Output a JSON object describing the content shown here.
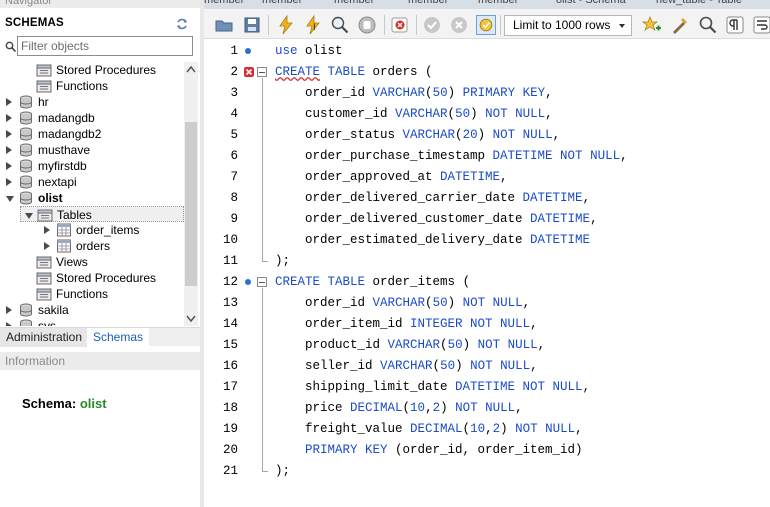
{
  "navigator": {
    "title": "Navigator",
    "schemas_header": "SCHEMAS",
    "filter_placeholder": "Filter objects"
  },
  "tree": {
    "top_items": [
      "Stored Procedures",
      "Functions"
    ],
    "schemas": [
      "hr",
      "madangdb",
      "madangdb2",
      "musthave",
      "myfirstdb",
      "nextapi"
    ],
    "open_schema": "olist",
    "tables_label": "Tables",
    "tables": [
      "order_items",
      "orders"
    ],
    "views_label": "Views",
    "stored_procedures_label": "Stored Procedures",
    "functions_label": "Functions",
    "after_schemas": [
      "sakila",
      "sys"
    ]
  },
  "bottom_tabs": {
    "administration": "Administration",
    "schemas": "Schemas"
  },
  "information": {
    "title": "Information",
    "schema_label": "Schema:",
    "schema_value": "olist"
  },
  "top_tabs": [
    "member",
    "member",
    "member",
    "member",
    "member",
    "olist - Schema",
    "new_table - Table"
  ],
  "toolbar": {
    "limit_label": "Limit to 1000 rows",
    "icons": [
      "open-folder-icon",
      "save-icon",
      "execute-icon",
      "execute-current-icon",
      "explain-icon",
      "stop-icon",
      "toggle-error-icon",
      "commit-icon",
      "rollback-icon",
      "autocommit-icon",
      "limit-select",
      "add-snippet-icon",
      "beautify-icon",
      "find-icon",
      "invisible-chars-icon",
      "wrap-icon"
    ]
  },
  "colors": {
    "keyword": "#1a4bc8",
    "schema_value": "#2a8a2a",
    "marker": "#2b6fd1",
    "error": "#d32f2f"
  },
  "editor": {
    "lines": [
      {
        "n": "1",
        "marker": "dot",
        "tokens": [
          [
            "kw",
            "use"
          ],
          [
            "t",
            " olist"
          ]
        ]
      },
      {
        "n": "2",
        "marker": "error",
        "fold": true,
        "tokens": [
          [
            "kwerr",
            "CREATE"
          ],
          [
            "t",
            " "
          ],
          [
            "kw",
            "TABLE"
          ],
          [
            "t",
            " orders ("
          ]
        ]
      },
      {
        "n": "3",
        "tokens": [
          [
            "t",
            "    order_id "
          ],
          [
            "kw",
            "VARCHAR"
          ],
          [
            "t",
            "("
          ],
          [
            "num",
            "50"
          ],
          [
            "t",
            ") "
          ],
          [
            "kw",
            "PRIMARY KEY"
          ],
          [
            "t",
            ","
          ]
        ]
      },
      {
        "n": "4",
        "tokens": [
          [
            "t",
            "    customer_id "
          ],
          [
            "kw",
            "VARCHAR"
          ],
          [
            "t",
            "("
          ],
          [
            "num",
            "50"
          ],
          [
            "t",
            ") "
          ],
          [
            "kw",
            "NOT NULL"
          ],
          [
            "t",
            ","
          ]
        ]
      },
      {
        "n": "5",
        "tokens": [
          [
            "t",
            "    order_status "
          ],
          [
            "kw",
            "VARCHAR"
          ],
          [
            "t",
            "("
          ],
          [
            "num",
            "20"
          ],
          [
            "t",
            ") "
          ],
          [
            "kw",
            "NOT NULL"
          ],
          [
            "t",
            ","
          ]
        ]
      },
      {
        "n": "6",
        "tokens": [
          [
            "t",
            "    order_purchase_timestamp "
          ],
          [
            "kw",
            "DATETIME NOT NULL"
          ],
          [
            "t",
            ","
          ]
        ]
      },
      {
        "n": "7",
        "tokens": [
          [
            "t",
            "    order_approved_at "
          ],
          [
            "kw",
            "DATETIME"
          ],
          [
            "t",
            ","
          ]
        ]
      },
      {
        "n": "8",
        "tokens": [
          [
            "t",
            "    order_delivered_carrier_date "
          ],
          [
            "kw",
            "DATETIME"
          ],
          [
            "t",
            ","
          ]
        ]
      },
      {
        "n": "9",
        "tokens": [
          [
            "t",
            "    order_delivered_customer_date "
          ],
          [
            "kw",
            "DATETIME"
          ],
          [
            "t",
            ","
          ]
        ]
      },
      {
        "n": "10",
        "tokens": [
          [
            "t",
            "    order_estimated_delivery_date "
          ],
          [
            "kw",
            "DATETIME"
          ]
        ]
      },
      {
        "n": "11",
        "tokens": [
          [
            "t",
            ");"
          ]
        ]
      },
      {
        "n": "12",
        "marker": "dot",
        "fold": true,
        "tokens": [
          [
            "kw",
            "CREATE"
          ],
          [
            "t",
            " "
          ],
          [
            "kw",
            "TABLE"
          ],
          [
            "t",
            " order_items ("
          ]
        ]
      },
      {
        "n": "13",
        "tokens": [
          [
            "t",
            "    order_id "
          ],
          [
            "kw",
            "VARCHAR"
          ],
          [
            "t",
            "("
          ],
          [
            "num",
            "50"
          ],
          [
            "t",
            ") "
          ],
          [
            "kw",
            "NOT NULL"
          ],
          [
            "t",
            ","
          ]
        ]
      },
      {
        "n": "14",
        "tokens": [
          [
            "t",
            "    order_item_id "
          ],
          [
            "kw",
            "INTEGER NOT NULL"
          ],
          [
            "t",
            ","
          ]
        ]
      },
      {
        "n": "15",
        "tokens": [
          [
            "t",
            "    product_id "
          ],
          [
            "kw",
            "VARCHAR"
          ],
          [
            "t",
            "("
          ],
          [
            "num",
            "50"
          ],
          [
            "t",
            ") "
          ],
          [
            "kw",
            "NOT NULL"
          ],
          [
            "t",
            ","
          ]
        ]
      },
      {
        "n": "16",
        "tokens": [
          [
            "t",
            "    seller_id "
          ],
          [
            "kw",
            "VARCHAR"
          ],
          [
            "t",
            "("
          ],
          [
            "num",
            "50"
          ],
          [
            "t",
            ") "
          ],
          [
            "kw",
            "NOT NULL"
          ],
          [
            "t",
            ","
          ]
        ]
      },
      {
        "n": "17",
        "tokens": [
          [
            "t",
            "    shipping_limit_date "
          ],
          [
            "kw",
            "DATETIME NOT NULL"
          ],
          [
            "t",
            ","
          ]
        ]
      },
      {
        "n": "18",
        "tokens": [
          [
            "t",
            "    price "
          ],
          [
            "kw",
            "DECIMAL"
          ],
          [
            "t",
            "("
          ],
          [
            "num",
            "10"
          ],
          [
            "t",
            ","
          ],
          [
            "num",
            "2"
          ],
          [
            "t",
            ") "
          ],
          [
            "kw",
            "NOT NULL"
          ],
          [
            "t",
            ","
          ]
        ]
      },
      {
        "n": "19",
        "tokens": [
          [
            "t",
            "    freight_value "
          ],
          [
            "kw",
            "DECIMAL"
          ],
          [
            "t",
            "("
          ],
          [
            "num",
            "10"
          ],
          [
            "t",
            ","
          ],
          [
            "num",
            "2"
          ],
          [
            "t",
            ") "
          ],
          [
            "kw",
            "NOT NULL"
          ],
          [
            "t",
            ","
          ]
        ]
      },
      {
        "n": "20",
        "tokens": [
          [
            "t",
            "    "
          ],
          [
            "kw",
            "PRIMARY KEY"
          ],
          [
            "t",
            " (order_id, order_item_id)"
          ]
        ]
      },
      {
        "n": "21",
        "tokens": [
          [
            "t",
            ");"
          ]
        ]
      }
    ]
  }
}
